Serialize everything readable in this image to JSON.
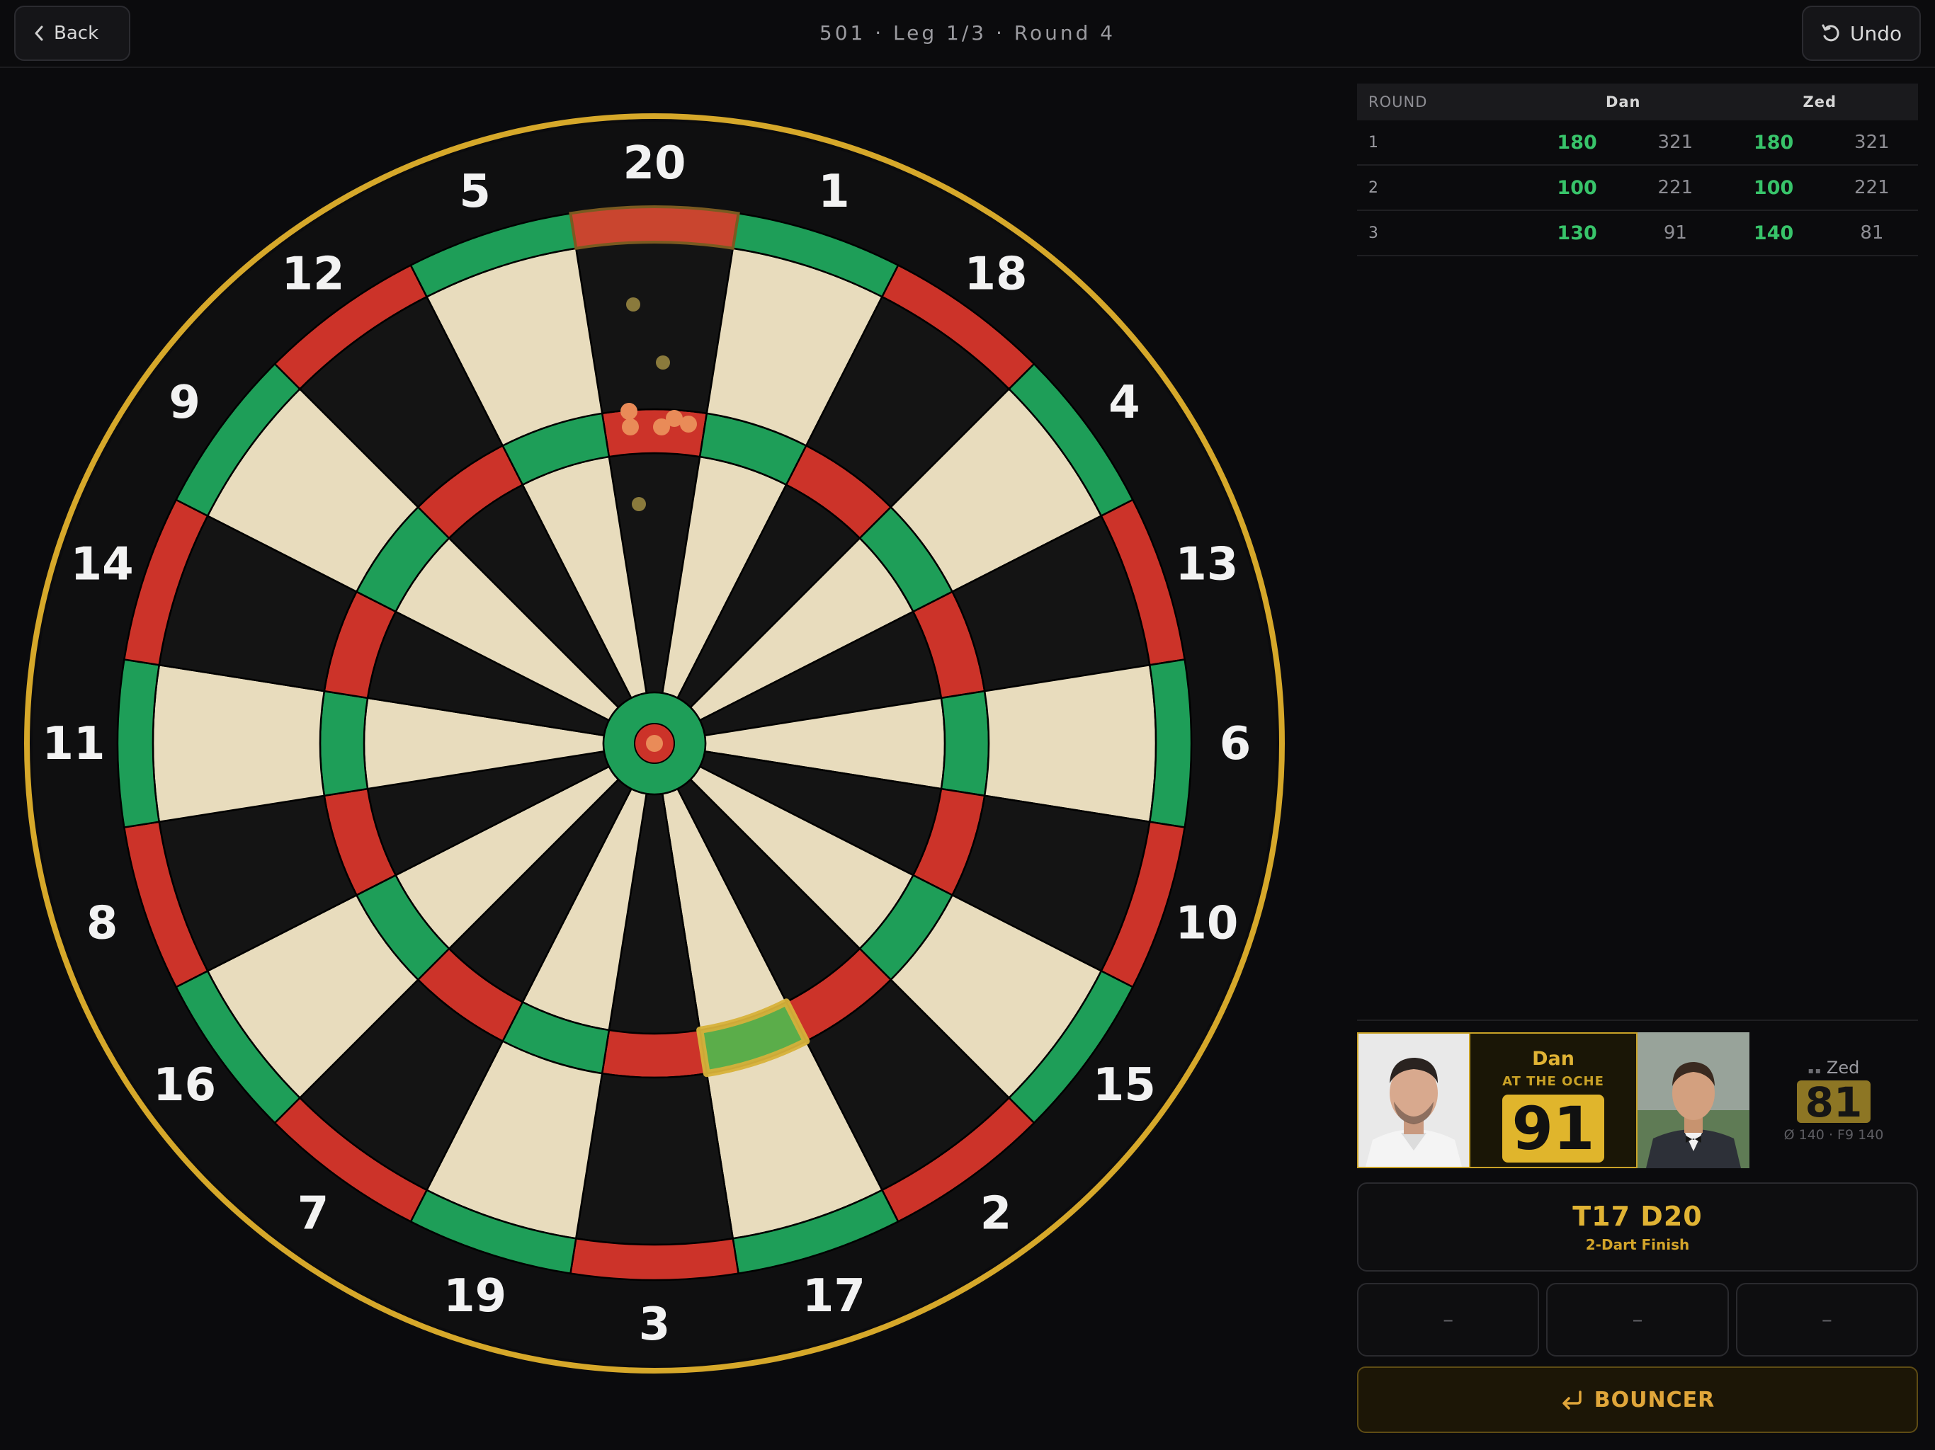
{
  "header": {
    "back_label": "Back",
    "title": "501 · Leg 1/3 · Round 4",
    "undo_label": "Undo"
  },
  "board": {
    "numbers": [
      20,
      1,
      18,
      4,
      13,
      6,
      10,
      15,
      2,
      17,
      3,
      19,
      7,
      16,
      8,
      11,
      14,
      9,
      12,
      5
    ],
    "colors": {
      "cream": "#e8dcbd",
      "black": "#141414",
      "red": "#cc3329",
      "green": "#1e9e58",
      "rim": "#d6a82a"
    },
    "highlighted_segment": "T17",
    "hits": [
      "T20",
      "T20",
      "T20",
      "T20",
      "T20",
      "bull"
    ]
  },
  "scoreboard": {
    "headers": {
      "round": "ROUND",
      "player1": "Dan",
      "player2": "Zed"
    },
    "rows": [
      {
        "round": "1",
        "p1_scored": "180",
        "p1_left": "321",
        "p2_scored": "180",
        "p2_left": "321"
      },
      {
        "round": "2",
        "p1_scored": "100",
        "p1_left": "221",
        "p2_scored": "100",
        "p2_left": "221"
      },
      {
        "round": "3",
        "p1_scored": "130",
        "p1_left": "91",
        "p2_scored": "140",
        "p2_left": "81"
      }
    ]
  },
  "players": {
    "active": {
      "name": "Dan",
      "status": "AT THE OCHE",
      "score": "91"
    },
    "waiting": {
      "name": "Zed",
      "score": "81",
      "stats": "Ø 140 · F9 140"
    }
  },
  "checkout": {
    "route": "T17 D20",
    "label": "2-Dart Finish"
  },
  "darts": [
    "–",
    "–",
    "–"
  ],
  "bouncer_label": "BOUNCER"
}
